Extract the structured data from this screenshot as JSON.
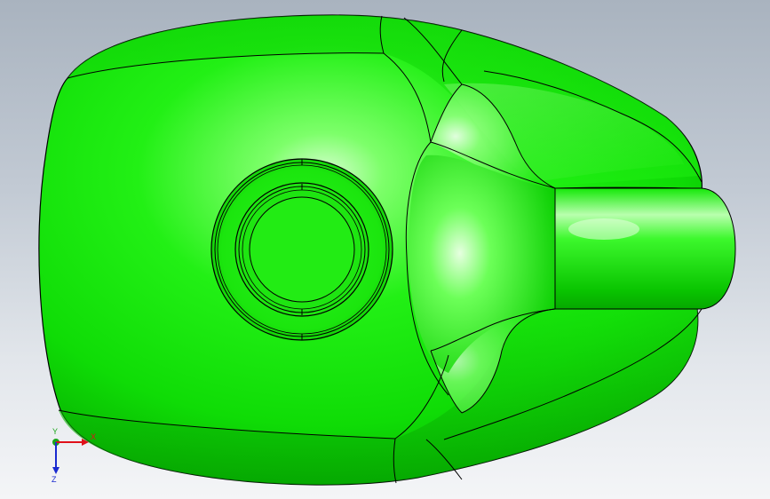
{
  "viewport": {
    "model_color": "#00ff00",
    "edge_color": "#000000"
  },
  "triad": {
    "x_label": "X",
    "y_label": "Y",
    "z_label": "Z",
    "x_color": "#e0101a",
    "y_color": "#1aa61a",
    "z_color": "#1a2ad0"
  }
}
